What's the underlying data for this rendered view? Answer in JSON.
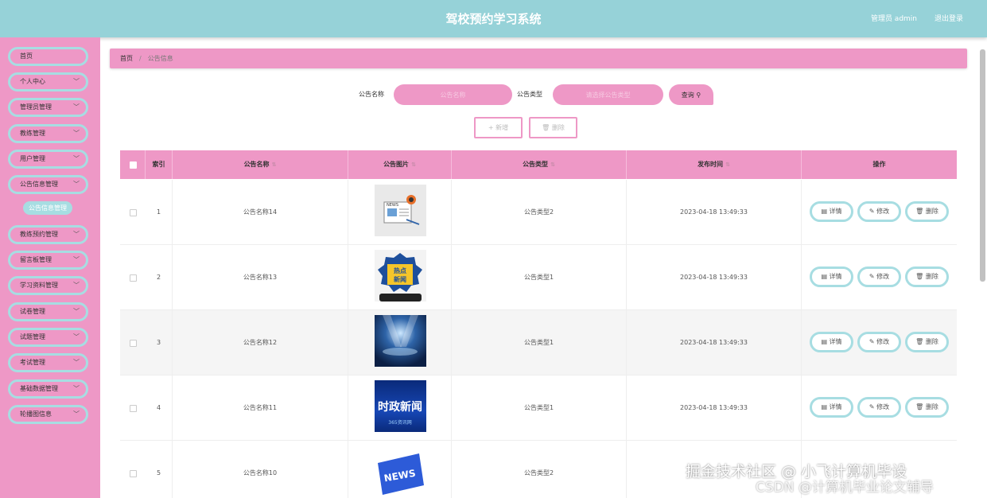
{
  "header": {
    "title": "驾校预约学习系统",
    "user": "管理员 admin",
    "logout": "退出登录"
  },
  "sidebar": {
    "items": [
      {
        "label": "首页"
      },
      {
        "label": "个人中心",
        "chevron": "﹀"
      },
      {
        "label": "管理员管理",
        "chevron": "﹀"
      },
      {
        "label": "教练管理",
        "chevron": "﹀"
      },
      {
        "label": "用户管理",
        "chevron": "﹀"
      },
      {
        "label": "公告信息管理",
        "chevron": "﹀"
      },
      {
        "label": "教练预约管理",
        "chevron": "﹀"
      },
      {
        "label": "留言板管理",
        "chevron": "﹀"
      },
      {
        "label": "学习资料管理",
        "chevron": "﹀"
      },
      {
        "label": "试卷管理",
        "chevron": "﹀"
      },
      {
        "label": "试题管理",
        "chevron": "﹀"
      },
      {
        "label": "考试管理",
        "chevron": "﹀"
      },
      {
        "label": "基础数据管理",
        "chevron": "﹀"
      },
      {
        "label": "轮播图信息",
        "chevron": "﹀"
      }
    ],
    "active_sub": "公告信息管理"
  },
  "breadcrumb": {
    "home": "首页",
    "current": "公告信息"
  },
  "search": {
    "name_label": "公告名称",
    "name_placeholder": "公告名称",
    "type_label": "公告类型",
    "type_placeholder": "请选择公告类型",
    "button": "查询"
  },
  "actions": {
    "add": "新增",
    "delete": "删除"
  },
  "table": {
    "headers": [
      "索引",
      "公告名称",
      "公告图片",
      "公告类型",
      "发布时间",
      "操作"
    ],
    "rows": [
      {
        "index": "1",
        "name": "公告名称14",
        "type": "公告类型2",
        "time": "2023-04-18 13:49:33"
      },
      {
        "index": "2",
        "name": "公告名称13",
        "type": "公告类型1",
        "time": "2023-04-18 13:49:33"
      },
      {
        "index": "3",
        "name": "公告名称12",
        "type": "公告类型1",
        "time": "2023-04-18 13:49:33"
      },
      {
        "index": "4",
        "name": "公告名称11",
        "type": "公告类型1",
        "time": "2023-04-18 13:49:33"
      },
      {
        "index": "5",
        "name": "公告名称10",
        "type": "公告类型2",
        "time": ""
      }
    ],
    "row_actions": {
      "detail": "详情",
      "edit": "修改",
      "delete": "删除"
    },
    "thumb_texts": {
      "news": "NEWS",
      "redian": "热点新闻",
      "shizheng": "时政新闻",
      "shizheng_sub": "365资讯网",
      "news5": "NEWS"
    }
  },
  "watermark": {
    "line1": "掘金技术社区 @ 小飞计算机毕设",
    "line2": "CSDN @计算机毕业论文辅导"
  },
  "colors": {
    "header": "#96d2d8",
    "pink": "#ee98c6",
    "teal_border": "#a7dde2"
  }
}
